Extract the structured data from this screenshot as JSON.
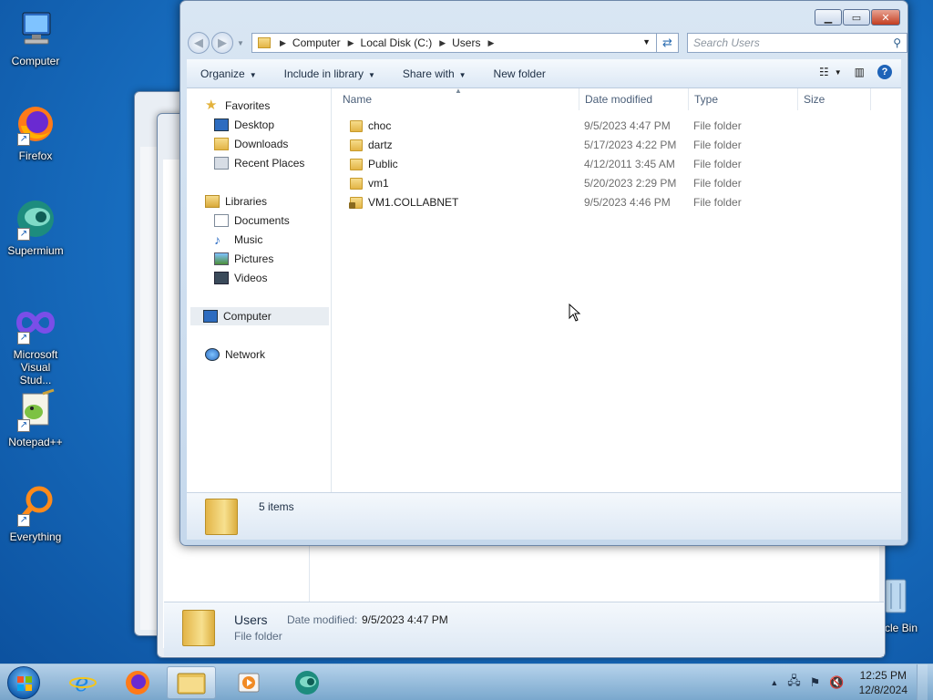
{
  "desktop": {
    "icons": [
      {
        "label": "Computer"
      },
      {
        "label": "Firefox"
      },
      {
        "label": "Supermium"
      },
      {
        "label": "Microsoft Visual Stud..."
      },
      {
        "label": "Notepad++"
      },
      {
        "label": "Everything"
      },
      {
        "label": "cle Bin"
      }
    ]
  },
  "window": {
    "address": {
      "crumbs": [
        "Computer",
        "Local Disk (C:)",
        "Users"
      ]
    },
    "search": {
      "placeholder": "Search Users"
    },
    "toolbar": {
      "organize": "Organize",
      "include_in_library": "Include in library",
      "share_with": "Share with",
      "new_folder": "New folder"
    },
    "nav": {
      "favorites": "Favorites",
      "desktop": "Desktop",
      "downloads": "Downloads",
      "recent_places": "Recent Places",
      "libraries": "Libraries",
      "documents": "Documents",
      "music": "Music",
      "pictures": "Pictures",
      "videos": "Videos",
      "computer": "Computer",
      "network": "Network"
    },
    "columns": {
      "name": "Name",
      "date_modified": "Date modified",
      "type": "Type",
      "size": "Size"
    },
    "files": [
      {
        "name": "choc",
        "date": "9/5/2023 4:47 PM",
        "type": "File folder"
      },
      {
        "name": "dartz",
        "date": "5/17/2023 4:22 PM",
        "type": "File folder"
      },
      {
        "name": "Public",
        "date": "4/12/2011 3:45 AM",
        "type": "File folder"
      },
      {
        "name": "vm1",
        "date": "5/20/2023 2:29 PM",
        "type": "File folder"
      },
      {
        "name": "VM1.COLLABNET",
        "date": "9/5/2023 4:46 PM",
        "type": "File folder"
      }
    ],
    "details": {
      "count": "5 items"
    }
  },
  "bg_window": {
    "details": {
      "name": "Users",
      "date_label": "Date modified:",
      "date_value": "9/5/2023 4:47 PM",
      "type": "File folder"
    }
  },
  "taskbar": {
    "time": "12:25 PM",
    "date": "12/8/2024"
  }
}
